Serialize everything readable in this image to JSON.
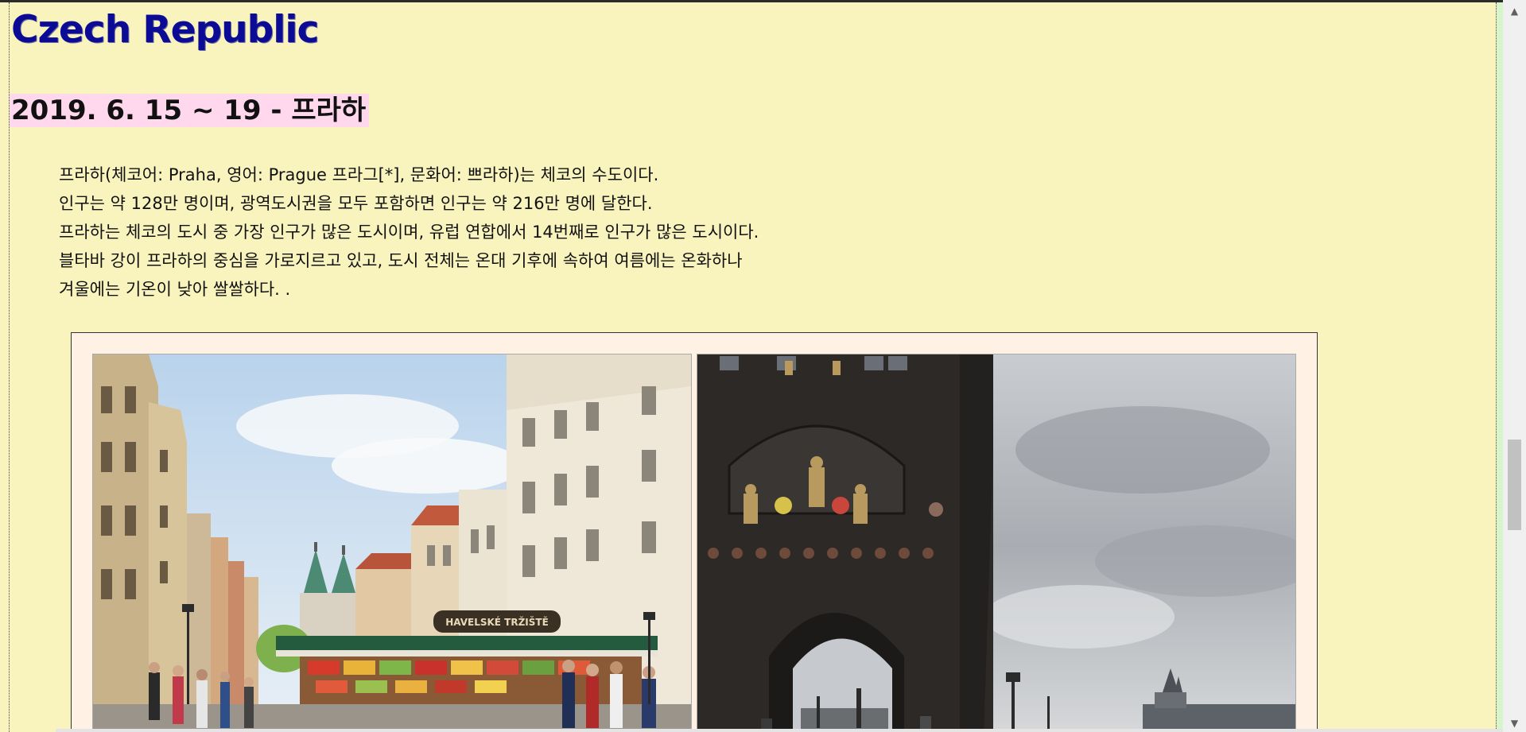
{
  "page": {
    "country_title": "Czech Republic",
    "trip_heading": "2019. 6. 15 ~ 19 - 프라하",
    "description_lines": [
      "프라하(체코어: Praha, 영어: Prague 프라그[*], 문화어: 쁘라하)는 체코의 수도이다.",
      "인구는 약 128만 명이며, 광역도시권을 모두 포함하면 인구는 약 216만 명에 달한다.",
      "프라하는 체코의 도시 중 가장 인구가 많은 도시이며, 유럽 연합에서 14번째로 인구가 많은 도시이다.",
      "블타바 강이 프라하의 중심을 가로지르고 있고, 도시 전체는 온대 기후에 속하여 여름에는 온화하나",
      "겨울에는 기온이 낮아 쌀쌀하다. ."
    ]
  },
  "photos": {
    "left_sign_text": "HAVELSKÉ TRŽIŠTĚ"
  },
  "colors": {
    "background": "#f9f4bd",
    "title": "#0b0b96",
    "heading_highlight": "#ffd8ee",
    "photo_frame": "#fff1e3"
  },
  "scrollbar": {
    "up_icon": "scroll-up-arrow-icon",
    "down_icon": "scroll-down-arrow-icon"
  }
}
